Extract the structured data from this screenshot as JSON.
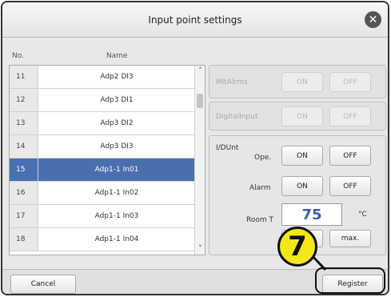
{
  "dialog": {
    "title": "Input point settings"
  },
  "list": {
    "header_no": "No.",
    "header_name": "Name",
    "rows": [
      {
        "no": "11",
        "name": "Adp2 DI3"
      },
      {
        "no": "12",
        "name": "Adp3 DI1"
      },
      {
        "no": "13",
        "name": "Adp3 DI2"
      },
      {
        "no": "14",
        "name": "Adp3 DI3"
      },
      {
        "no": "15",
        "name": "Adp1-1 In01"
      },
      {
        "no": "16",
        "name": "Adp1-1 In02"
      },
      {
        "no": "17",
        "name": "Adp1-1 In03"
      },
      {
        "no": "18",
        "name": "Adp1-1 In04"
      }
    ],
    "selected_no": "15"
  },
  "panels": {
    "mltalrms": {
      "label": "MltAlrms",
      "on": "ON",
      "off": "OFF"
    },
    "digitalinput": {
      "label": "DigitalInput",
      "on": "ON",
      "off": "OFF"
    },
    "idunt": {
      "label": "I/DUnt",
      "ope_label": "Ope.",
      "alarm_label": "Alarm",
      "roomt_label": "Room T",
      "roomt_value": "75",
      "unit": "°C",
      "on": "ON",
      "off": "OFF",
      "max_label": "max."
    }
  },
  "footer": {
    "cancel": "Cancel",
    "register": "Register"
  },
  "callout": {
    "number": "7",
    "color": "#f3e71c"
  },
  "colors": {
    "selected_row": "#4a6fb1",
    "value_text": "#3b5fa4"
  }
}
